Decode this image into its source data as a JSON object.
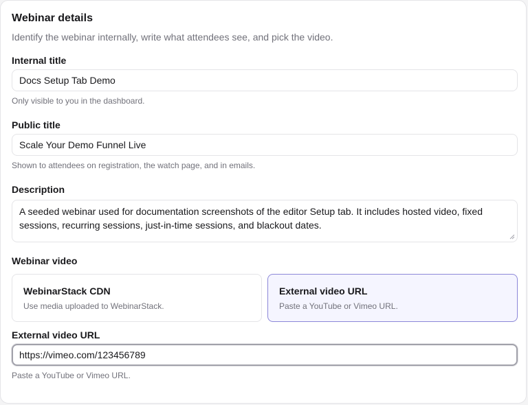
{
  "section": {
    "title": "Webinar details",
    "subtitle": "Identify the webinar internally, write what attendees see, and pick the video."
  },
  "internal_title": {
    "label": "Internal title",
    "value": "Docs Setup Tab Demo",
    "help": "Only visible to you in the dashboard."
  },
  "public_title": {
    "label": "Public title",
    "value": "Scale Your Demo Funnel Live",
    "help": "Shown to attendees on registration, the watch page, and in emails."
  },
  "description": {
    "label": "Description",
    "value": "A seeded webinar used for documentation screenshots of the editor Setup tab. It includes hosted video, fixed sessions, recurring sessions, just-in-time sessions, and blackout dates."
  },
  "video": {
    "label": "Webinar video",
    "options": [
      {
        "title": "WebinarStack CDN",
        "description": "Use media uploaded to WebinarStack.",
        "selected": false
      },
      {
        "title": "External video URL",
        "description": "Paste a YouTube or Vimeo URL.",
        "selected": true
      }
    ]
  },
  "external_url": {
    "label": "External video URL",
    "value": "https://vimeo.com/123456789",
    "help": "Paste a YouTube or Vimeo URL."
  },
  "colors": {
    "selected_border": "#8b86d8",
    "selected_background": "#f5f5ff",
    "muted_text": "#71717a"
  }
}
